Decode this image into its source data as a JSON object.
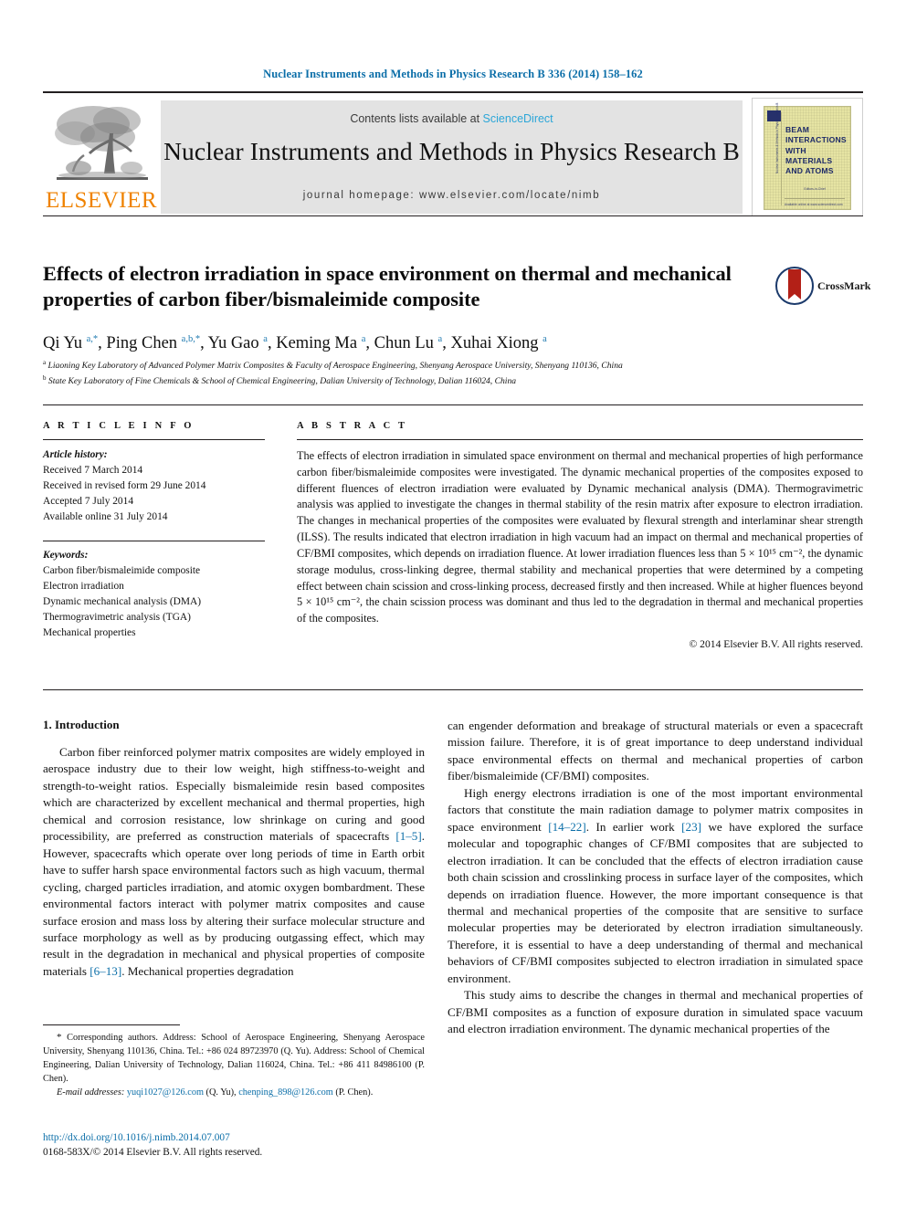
{
  "running_head": "Nuclear Instruments and Methods in Physics Research B 336 (2014) 158–162",
  "masthead": {
    "publisher_name": "ELSEVIER",
    "contents_prefix": "Contents lists available at ",
    "contents_link": "ScienceDirect",
    "journal_name": "Nuclear Instruments and Methods in Physics Research B",
    "homepage": "journal homepage: www.elsevier.com/locate/nimb",
    "cover": {
      "title_lines": "BEAM INTERACTIONS WITH MATERIALS AND ATOMS",
      "spine_text": "Nuclear Instruments & Methods in Physics Research B",
      "editor_line": "Editors-in-Chief",
      "bottom_line": "Available online at www.sciencedirect.com"
    }
  },
  "article": {
    "title": "Effects of electron irradiation in space environment on thermal and mechanical properties of carbon fiber/bismaleimide composite",
    "crossmark_label": "CrossMark",
    "authors_html": "Qi Yu <sup>a,*</sup>, Ping Chen <sup>a,b,</sup><sup>*</sup>, Yu Gao <sup>a</sup>, Keming Ma <sup>a</sup>, Chun Lu <sup>a</sup>, Xuhai Xiong <sup>a</sup>",
    "affiliation_a": "Liaoning Key Laboratory of Advanced Polymer Matrix Composites & Faculty of Aerospace Engineering, Shenyang Aerospace University, Shenyang 110136, China",
    "affiliation_b": "State Key Laboratory of Fine Chemicals & School of Chemical Engineering, Dalian University of Technology, Dalian 116024, China"
  },
  "article_info": {
    "heading": "A R T I C L E  I N F O",
    "history_label": "Article history:",
    "history": [
      "Received 7 March 2014",
      "Received in revised form 29 June 2014",
      "Accepted 7 July 2014",
      "Available online 31 July 2014"
    ],
    "keywords_label": "Keywords:",
    "keywords": [
      "Carbon fiber/bismaleimide composite",
      "Electron irradiation",
      "Dynamic mechanical analysis (DMA)",
      "Thermogravimetric analysis (TGA)",
      "Mechanical properties"
    ]
  },
  "abstract": {
    "heading": "A B S T R A C T",
    "text": "The effects of electron irradiation in simulated space environment on thermal and mechanical properties of high performance carbon fiber/bismaleimide composites were investigated. The dynamic mechanical properties of the composites exposed to different fluences of electron irradiation were evaluated by Dynamic mechanical analysis (DMA). Thermogravimetric analysis was applied to investigate the changes in thermal stability of the resin matrix after exposure to electron irradiation. The changes in mechanical properties of the composites were evaluated by flexural strength and interlaminar shear strength (ILSS). The results indicated that electron irradiation in high vacuum had an impact on thermal and mechanical properties of CF/BMI composites, which depends on irradiation fluence. At lower irradiation fluences less than 5 × 10¹⁵ cm⁻², the dynamic storage modulus, cross-linking degree, thermal stability and mechanical properties that were determined by a competing effect between chain scission and cross-linking process, decreased firstly and then increased. While at higher fluences beyond 5 × 10¹⁵ cm⁻², the chain scission process was dominant and thus led to the degradation in thermal and mechanical properties of the composites.",
    "copyright": "© 2014 Elsevier B.V. All rights reserved."
  },
  "body": {
    "section_heading": "1. Introduction",
    "left_paragraph_1_a": "Carbon fiber reinforced polymer matrix composites are widely employed in aerospace industry due to their low weight, high stiffness-to-weight and strength-to-weight ratios. Especially bismaleimide resin based composites which are characterized by excellent mechanical and thermal properties, high chemical and corrosion resistance, low shrinkage on curing and good processibility, are preferred as construction materials of spacecrafts ",
    "left_ref_1": "[1–5]",
    "left_paragraph_1_b": ". However, spacecrafts which operate over long periods of time in Earth orbit have to suffer harsh space environmental factors such as high vacuum, thermal cycling, charged particles irradiation, and atomic oxygen bombardment. These environmental factors interact with polymer matrix composites and cause surface erosion and mass loss by altering their surface molecular structure and surface morphology as well as by producing outgassing effect, which may result in the degradation in mechanical and physical properties of composite materials ",
    "left_ref_2": "[6–13]",
    "left_paragraph_1_c": ". Mechanical properties degradation",
    "right_paragraph_1_a": "can engender deformation and breakage of structural materials or even a spacecraft mission failure. Therefore, it is of great importance to deep understand individual space environmental effects on thermal and mechanical properties of carbon fiber/bismaleimide (CF/BMI) composites.",
    "right_paragraph_2_a": "High energy electrons irradiation is one of the most important environmental factors that constitute the main radiation damage to polymer matrix composites in space environment ",
    "right_ref_1": "[14–22]",
    "right_paragraph_2_b": ". In earlier work ",
    "right_ref_2": "[23]",
    "right_paragraph_2_c": " we have explored the surface molecular and topographic changes of CF/BMI composites that are subjected to electron irradiation. It can be concluded that the effects of electron irradiation cause both chain scission and crosslinking process in surface layer of the composites, which depends on irradiation fluence. However, the more important consequence is that thermal and mechanical properties of the composite that are sensitive to surface molecular properties may be deteriorated by electron irradiation simultaneously. Therefore, it is essential to have a deep understanding of thermal and mechanical behaviors of CF/BMI composites subjected to electron irradiation in simulated space environment.",
    "right_paragraph_3": "This study aims to describe the changes in thermal and mechanical properties of CF/BMI composites as a function of exposure duration in simulated space vacuum and electron irradiation environment. The dynamic mechanical properties of the"
  },
  "footnote": {
    "star": "*",
    "corresponding_text": " Corresponding authors. Address: School of Aerospace Engineering, Shenyang Aerospace University, Shenyang 110136, China. Tel.: +86 024 89723970 (Q. Yu). Address: School of Chemical Engineering, Dalian University of Technology, Dalian 116024, China. Tel.: +86 411 84986100 (P. Chen).",
    "email_label": "E-mail addresses:",
    "email_1": "yuqi1027@126.com",
    "email_1_owner": " (Q. Yu), ",
    "email_2": "chenping_898@126.com",
    "email_2_owner": " (P. Chen)."
  },
  "doi_block": {
    "doi": "http://dx.doi.org/10.1016/j.nimb.2014.07.007",
    "issn_line": "0168-583X/© 2014 Elsevier B.V. All rights reserved."
  }
}
